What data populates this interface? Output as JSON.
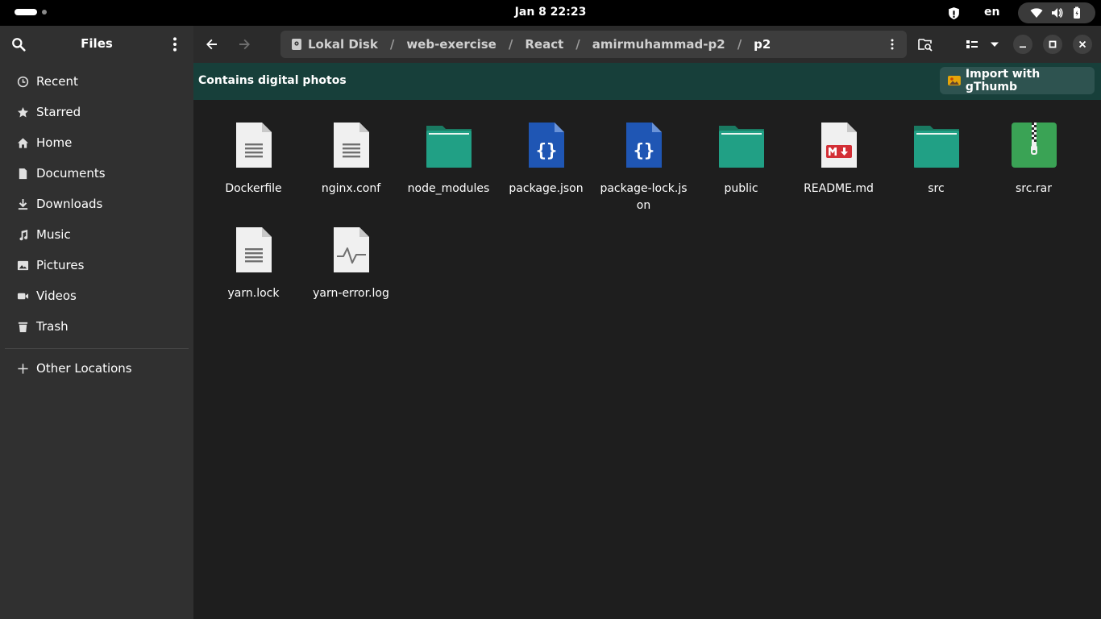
{
  "topbar": {
    "clock": "Jan 8  22:23",
    "language": "en"
  },
  "sidebar": {
    "title": "Files",
    "items": [
      {
        "label": "Recent",
        "icon": "clock-icon"
      },
      {
        "label": "Starred",
        "icon": "star-icon"
      },
      {
        "label": "Home",
        "icon": "home-icon"
      },
      {
        "label": "Documents",
        "icon": "document-icon"
      },
      {
        "label": "Downloads",
        "icon": "download-icon"
      },
      {
        "label": "Music",
        "icon": "music-icon"
      },
      {
        "label": "Pictures",
        "icon": "picture-icon"
      },
      {
        "label": "Videos",
        "icon": "video-icon"
      },
      {
        "label": "Trash",
        "icon": "trash-icon"
      }
    ],
    "other": "Other Locations"
  },
  "pathbar": {
    "crumbs": [
      "Lokal Disk",
      "web-exercise",
      "React",
      "amirmuhammad-p2",
      "p2"
    ],
    "separator": "/"
  },
  "banner": {
    "text": "Contains digital photos",
    "button": "Import with gThumb"
  },
  "files": [
    {
      "name": "Dockerfile",
      "type": "text"
    },
    {
      "name": "nginx.conf",
      "type": "text"
    },
    {
      "name": "node_modules",
      "type": "folder"
    },
    {
      "name": "package.json",
      "type": "json"
    },
    {
      "name": "package-lock.json",
      "type": "json"
    },
    {
      "name": "public",
      "type": "folder"
    },
    {
      "name": "README.md",
      "type": "markdown"
    },
    {
      "name": "src",
      "type": "folder"
    },
    {
      "name": "src.rar",
      "type": "archive"
    },
    {
      "name": "yarn.lock",
      "type": "text"
    },
    {
      "name": "yarn-error.log",
      "type": "log"
    }
  ],
  "colors": {
    "folder": "#26a269",
    "json": "#1c58b5",
    "archive": "#33a05a",
    "markdown": "#c01c28",
    "banner": "#173f3a"
  }
}
